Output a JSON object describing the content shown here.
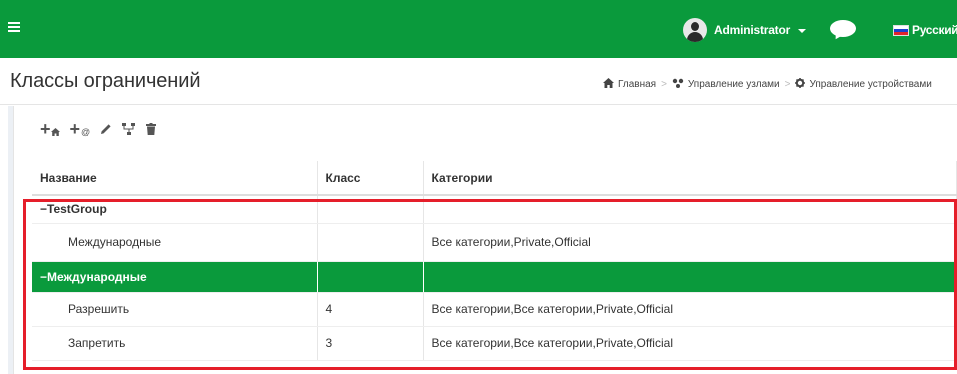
{
  "topbar": {
    "menu_icon": "hamburger-icon",
    "user_label": "Administrator",
    "user_icon": "user-avatar-icon",
    "chat_icon": "chat-bubble-icon",
    "language_label": "Русский",
    "flag_colors": [
      "#ffffff",
      "#1c3fd1",
      "#e0242c"
    ],
    "bar_color": "#0a9a3c"
  },
  "header": {
    "title": "Классы ограничений",
    "breadcrumb": [
      {
        "label": "Главная",
        "icon": "home-icon"
      },
      {
        "label": "Управление узлами",
        "icon": "nodes-icon"
      },
      {
        "label": "Управление устройствами",
        "icon": "gear-icon"
      }
    ]
  },
  "toolbar": {
    "buttons": [
      {
        "name": "add-group",
        "icon": "plus-home-icon"
      },
      {
        "name": "add-class",
        "icon": "plus-at-icon"
      },
      {
        "name": "edit",
        "icon": "pencil-icon"
      },
      {
        "name": "tree",
        "icon": "hierarchy-icon"
      },
      {
        "name": "delete",
        "icon": "trash-icon"
      }
    ]
  },
  "table": {
    "columns": [
      "Название",
      "Класс",
      "Категории"
    ],
    "rows": [
      {
        "type": "group",
        "name": "TestGroup",
        "class": "",
        "categories": ""
      },
      {
        "type": "item",
        "name": "Международные",
        "class": "",
        "categories": "Все категории,Private,Official"
      },
      {
        "type": "group-active",
        "name": "Международные",
        "class": "",
        "categories": ""
      },
      {
        "type": "item",
        "name": "Разрешить",
        "class": "4",
        "categories": "Все категории,Все категории,Private,Official"
      },
      {
        "type": "item",
        "name": "Запретить",
        "class": "3",
        "categories": "Все категории,Все категории,Private,Official"
      }
    ],
    "collapse_marker": "−"
  },
  "colors": {
    "accent": "#0a9a3c",
    "highlight_border": "#e51e2a"
  }
}
